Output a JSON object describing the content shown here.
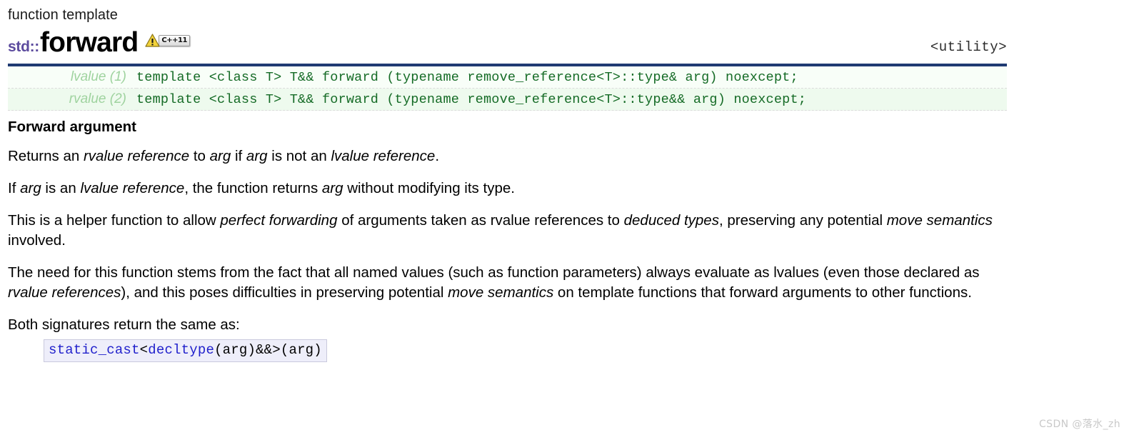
{
  "header": {
    "kind": "function template",
    "namespace": "std::",
    "name": "forward",
    "standard_badge": "C++11",
    "warning_icon": "warning-triangle-icon",
    "header_file": "<utility>"
  },
  "signatures": [
    {
      "label": "lvalue (1)",
      "code": "template <class T> T&& forward (typename remove_reference<T>::type& arg) noexcept;"
    },
    {
      "label": "rvalue (2)",
      "code": "template <class T> T&& forward (typename remove_reference<T>::type&& arg) noexcept;"
    }
  ],
  "section_heading": "Forward argument",
  "paragraphs": {
    "p1": {
      "a": "Returns an ",
      "i1": "rvalue reference",
      "b": " to ",
      "i2": "arg",
      "c": " if ",
      "i3": "arg",
      "d": " is not an ",
      "i4": "lvalue reference",
      "e": "."
    },
    "p2": {
      "a": "If ",
      "i1": "arg",
      "b": " is an ",
      "i2": "lvalue reference",
      "c": ", the function returns ",
      "i3": "arg",
      "d": " without modifying its type."
    },
    "p3": {
      "a": "This is a helper function to allow ",
      "i1": "perfect forwarding",
      "b": " of arguments taken as rvalue references to ",
      "i2": "deduced types",
      "c": ", preserving any potential ",
      "i3": "move semantics",
      "d": " involved."
    },
    "p4": {
      "a": "The need for this function stems from the fact that all named values (such as function parameters) always evaluate as lvalues (even those declared as ",
      "i1": "rvalue references",
      "b": "), and this poses difficulties in preserving potential ",
      "i2": "move semantics",
      "c": " on template functions that forward arguments to other functions."
    },
    "p5": {
      "a": "Both signatures return the same as:"
    }
  },
  "code_example": {
    "kw1": "static_cast",
    "mid": "<",
    "kw2": "decltype",
    "tail": "(arg)&&>(arg)"
  },
  "watermark": "CSDN @落水_zh",
  "colors": {
    "accent_rule": "#1f3a72",
    "namespace": "#5c4b9e",
    "signature_code": "#156b26",
    "signature_label": "#9fd39f",
    "code_keyword": "#2222cc",
    "code_bg": "#eeeefa"
  }
}
